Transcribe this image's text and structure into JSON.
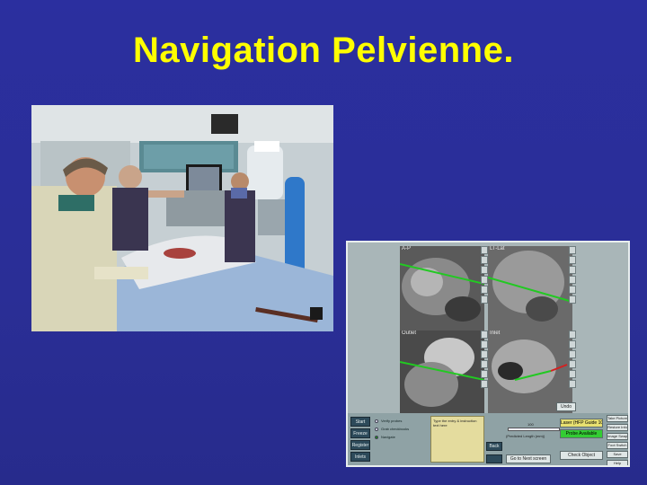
{
  "slide": {
    "title": "Navigation Pelvienne."
  },
  "colors": {
    "background": "#2a2f9a",
    "title": "#ffff00",
    "guide_line": "#22c922",
    "planned_line": "#d42020"
  },
  "photo": {
    "subject": "surgeons-operating-with-navigation-system"
  },
  "navigation_screen": {
    "views": [
      {
        "label": "A-P"
      },
      {
        "label": "LT-Lat"
      },
      {
        "label": "Outlet"
      },
      {
        "label": "Inlet"
      }
    ],
    "left_buttons": [
      "Start",
      "Freeze",
      "Register",
      "Inlets"
    ],
    "radio_options": [
      "Verify probes",
      "Grab checkbooks",
      "Navigate"
    ],
    "note_text": "Type the entry & instruction text here",
    "length_value": "100",
    "length_label": "(Predicted Length (mm))",
    "center_buttons": [
      "Back",
      "Go to Next screen"
    ],
    "info_buttons": [
      "Laser (HFP Guide 100)",
      "Probe Available",
      "Check Object"
    ],
    "side_buttons": [
      "Take Picture",
      "Restore Info",
      "Image Swap",
      "Foot Switch",
      "Save",
      "Help"
    ],
    "info_label": "Undo"
  }
}
